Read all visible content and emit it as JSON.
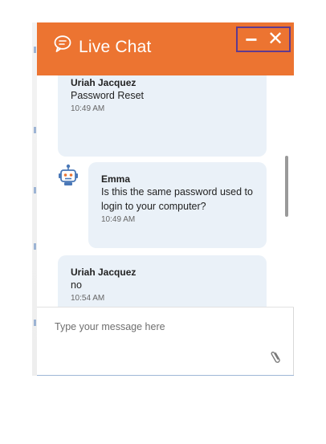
{
  "header": {
    "title": "Live Chat",
    "icon": "chat-bubble-icon",
    "minimize_label": "−",
    "close_label": "✕",
    "color": "#ec7431"
  },
  "messages": [
    {
      "sender": "Uriah Jacquez",
      "text": "Password Reset",
      "time": "10:49 AM"
    },
    {
      "sender": "Emma",
      "text": "Is this the same password used to login to your computer?",
      "time": "10:49 AM",
      "avatar": "robot-icon"
    },
    {
      "sender": "Uriah Jacquez",
      "text": "no",
      "time": "10:54 AM"
    }
  ],
  "composer": {
    "placeholder": "Type your message here",
    "value": "",
    "attach_icon": "paperclip-icon"
  },
  "colors": {
    "bubble": "#eaf1f8",
    "controls_highlight": "#5f3a8f"
  }
}
